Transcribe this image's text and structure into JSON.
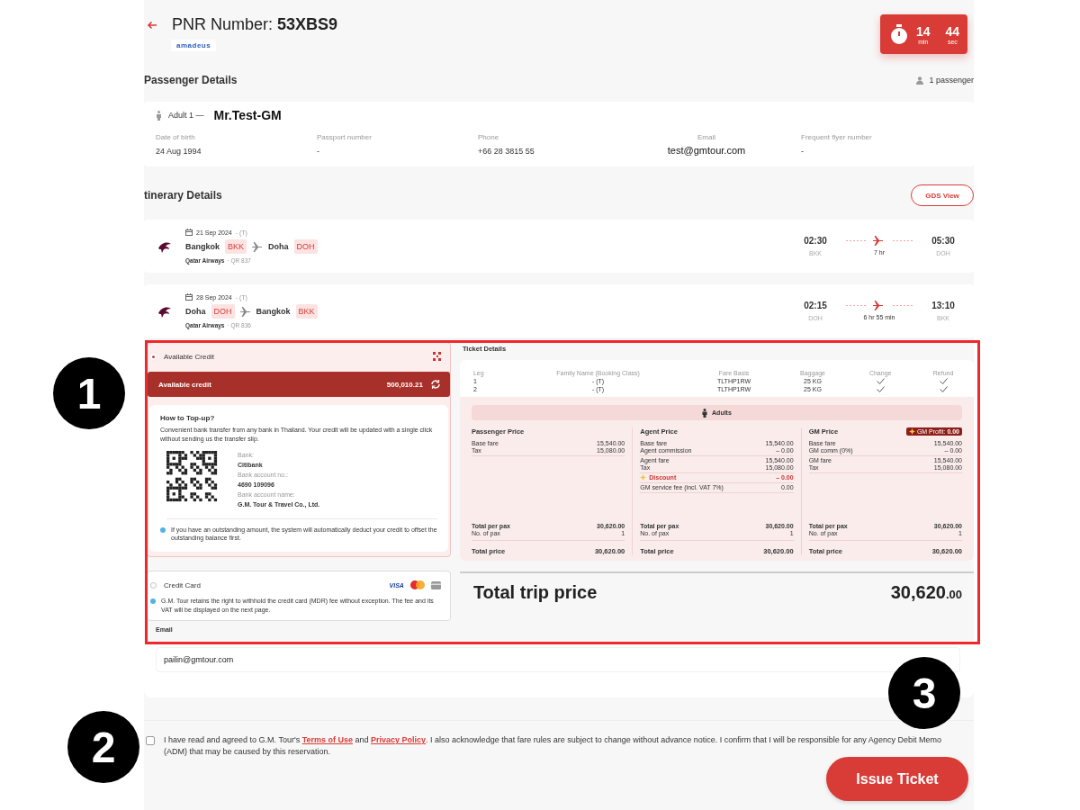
{
  "header": {
    "title_label": "PNR Number:",
    "pnr": "53XBS9",
    "gds_logo": "amadeus",
    "timer": {
      "minutes": "14",
      "minutes_unit": "min",
      "seconds": "44",
      "seconds_unit": "sec"
    }
  },
  "passenger_details": {
    "title": "Passenger Details",
    "count": "1 passenger",
    "passengers": [
      {
        "type": "Adult 1 —",
        "name": "Mr.Test-GM",
        "fields": [
          {
            "label": "Date of birth",
            "value": "24 Aug 1994"
          },
          {
            "label": "Passport number",
            "value": "-"
          },
          {
            "label": "Phone",
            "value": "+66 28 3815 55"
          },
          {
            "label": "Email",
            "value": "test@gmtour.com"
          },
          {
            "label": "Frequent flyer number",
            "value": "-"
          }
        ]
      }
    ]
  },
  "itinerary": {
    "title": "tinerary Details",
    "gds_button": "GDS View",
    "flights": [
      {
        "date": "21 Sep 2024",
        "fare_class": "- (T)",
        "from_city": "Bangkok",
        "from_code": "BKK",
        "to_city": "Doha",
        "to_code": "DOH",
        "airline": "Qatar Airways",
        "flight_no": "· QR 837",
        "depart_time": "02:30",
        "depart_code": "BKK",
        "duration": "7 hr",
        "arrive_time": "05:30",
        "arrive_code": "DOH"
      },
      {
        "date": "28 Sep 2024",
        "fare_class": "- (T)",
        "from_city": "Doha",
        "from_code": "DOH",
        "to_city": "Bangkok",
        "to_code": "BKK",
        "airline": "Qatar Airways",
        "flight_no": "· QR 836",
        "depart_time": "02:15",
        "depart_code": "DOH",
        "duration": "6 hr 55 min",
        "arrive_time": "13:10",
        "arrive_code": "BKK"
      }
    ]
  },
  "payment": {
    "methods": [
      {
        "kind": "credit",
        "label": "Available Credit",
        "selected": true,
        "balance_label": "Available credit",
        "balance": "500,010.21",
        "topup_title": "How to Top-up?",
        "topup_text": "Convenient bank transfer from any bank in Thailand. Your credit will be updated with a single click without sending us the transfer slip.",
        "bank_fields": [
          {
            "label": "Bank:",
            "value": "Citibank"
          },
          {
            "label": "Bank account no.:",
            "value": "4690 109096"
          },
          {
            "label": "Bank account name:",
            "value": "G.M. Tour & Travel Co., Ltd."
          }
        ],
        "note": "If you have an outstanding amount, the system will automatically deduct your credit to offset the outstanding balance first."
      },
      {
        "kind": "card",
        "label": "Credit Card",
        "selected": false,
        "brand_label": "VISA",
        "note": "G.M. Tour retains the right to withhold the credit card (MDR) fee without exception. The fee and its VAT will be displayed on the next page."
      }
    ],
    "email": {
      "label": "Email",
      "value": "pailin@gmtour.com"
    }
  },
  "ticket_details": {
    "title": "Ticket Details",
    "columns": [
      "Leg",
      "Family Name (Booking Class)",
      "Fare Basis",
      "Baggage",
      "Change",
      "Refund"
    ],
    "rows": [
      {
        "leg": "1",
        "family": "- (T)",
        "fare_basis": "TLTHP1RW",
        "baggage": "25 KG",
        "change": true,
        "refund": true
      },
      {
        "leg": "2",
        "family": "- (T)",
        "fare_basis": "TLTHP1RW",
        "baggage": "25 KG",
        "change": true,
        "refund": true
      }
    ],
    "pax_type": "Adults",
    "price_columns": [
      {
        "title": "Passenger Price",
        "sections": [
          [
            {
              "label": "Base fare",
              "value": "15,540.00"
            },
            {
              "label": "Tax",
              "value": "15,080.00"
            }
          ]
        ],
        "totals": [
          {
            "label": "Total per pax",
            "value": "30,620.00"
          },
          {
            "label": "No. of pax",
            "value": "1"
          }
        ],
        "total": {
          "label": "Total price",
          "value": "30,620.00"
        }
      },
      {
        "title": "Agent Price",
        "sections": [
          [
            {
              "label": "Base fare",
              "value": "15,540.00"
            },
            {
              "label": "Agent commission",
              "value": "– 0.00"
            }
          ],
          [
            {
              "label": "Agent fare",
              "value": "15,540.00"
            },
            {
              "label": "Tax",
              "value": "15,080.00"
            }
          ],
          [
            {
              "label": "Discount",
              "value": "– 0.00",
              "kind": "discount"
            }
          ],
          [
            {
              "label": "GM service fee (incl. VAT 7%)",
              "value": "0.00"
            }
          ]
        ],
        "totals": [
          {
            "label": "Total per pax",
            "value": "30,620.00"
          },
          {
            "label": "No. of pax",
            "value": "1"
          }
        ],
        "total": {
          "label": "Total price",
          "value": "30,620.00"
        }
      },
      {
        "title": "GM Price",
        "badge": {
          "label": "GM Profit:",
          "value": "0.00"
        },
        "sections": [
          [
            {
              "label": "Base fare",
              "value": "15,540.00"
            },
            {
              "label": "GM comm (0%)",
              "value": "– 0.00"
            }
          ],
          [
            {
              "label": "GM fare",
              "value": "15,540.00"
            },
            {
              "label": "Tax",
              "value": "15,080.00"
            }
          ]
        ],
        "totals": [
          {
            "label": "Total per pax",
            "value": "30,620.00"
          },
          {
            "label": "No. of pax",
            "value": "1"
          }
        ],
        "total": {
          "label": "Total price",
          "value": "30,620.00"
        }
      }
    ],
    "total_trip": {
      "label": "Total trip price",
      "amount": "30,620",
      "decimals": ".00"
    }
  },
  "agreement": {
    "checked": false,
    "parts": [
      {
        "text": "I have read and agreed to G.M. Tour's "
      },
      {
        "text": "Terms of Use",
        "link": true
      },
      {
        "text": " and "
      },
      {
        "text": "Privacy Policy",
        "link": true
      },
      {
        "text": ". I also acknowledge that fare rules are subject to change without advance notice. I confirm that I will be responsible for any Agency Debit Memo (ADM) that may be caused by this reservation."
      }
    ]
  },
  "issue_button": "Issue Ticket",
  "callouts": [
    {
      "number": "1"
    },
    {
      "number": "2"
    },
    {
      "number": "3"
    }
  ]
}
